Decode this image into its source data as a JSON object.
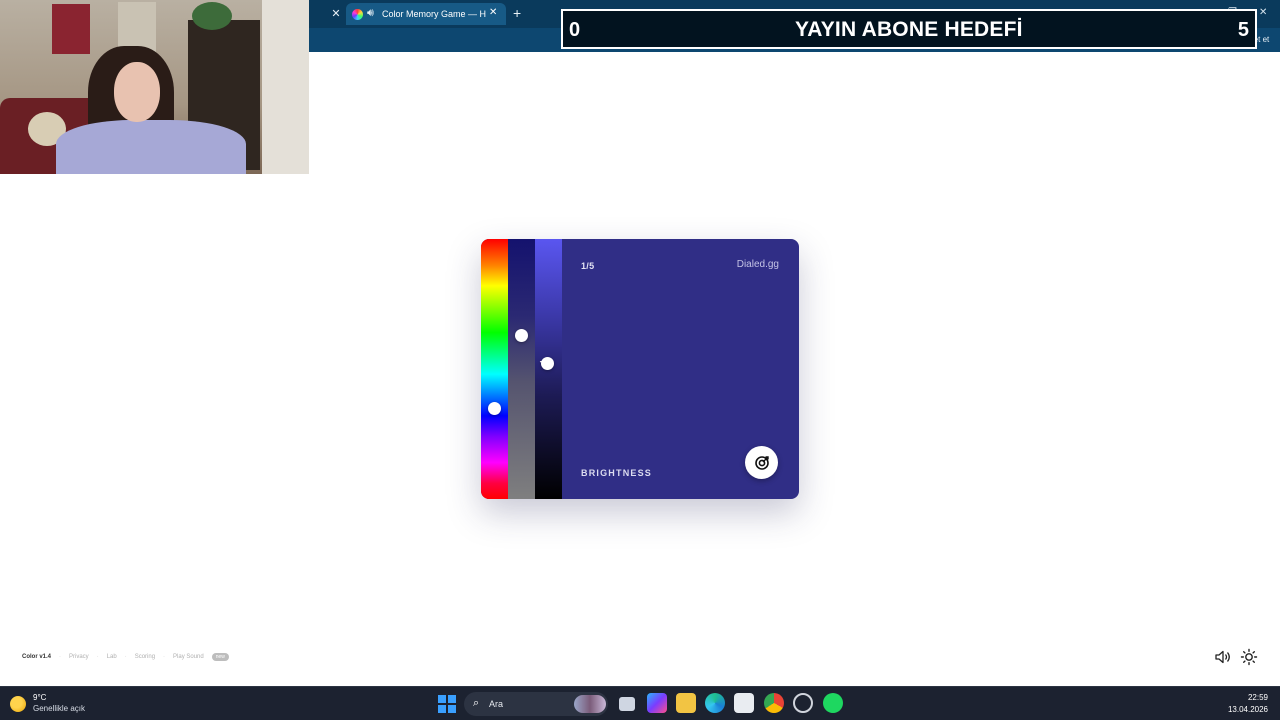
{
  "browser": {
    "tab_title": "Color Memory Game — How",
    "tab_favicon": "color-wheel-icon",
    "tab_audio_icon": "speaker-icon",
    "new_tab_glyph": "+",
    "copilot_label": "Sohbet et"
  },
  "overlay": {
    "current_count": "0",
    "goal_label": "YAYIN ABONE HEDEFİ",
    "goal_target": "5"
  },
  "game": {
    "round": "1/5",
    "brand": "Dialed.gg",
    "active_slider": "BRIGHTNESS",
    "target_color": "#302e86",
    "hue_level": 0.65,
    "saturation_level": 0.37,
    "brightness_level": 0.48,
    "submit_icon": "target-check-icon"
  },
  "footer": {
    "version": "Color v1.4",
    "links": [
      "Privacy",
      "Lab",
      "Scoring",
      "Play Sound"
    ],
    "badge": "new"
  },
  "taskbar": {
    "temperature": "9°C",
    "condition": "Genellikle açık",
    "search_placeholder": "Ara",
    "time": "22:59",
    "date": "13.04.2026"
  }
}
